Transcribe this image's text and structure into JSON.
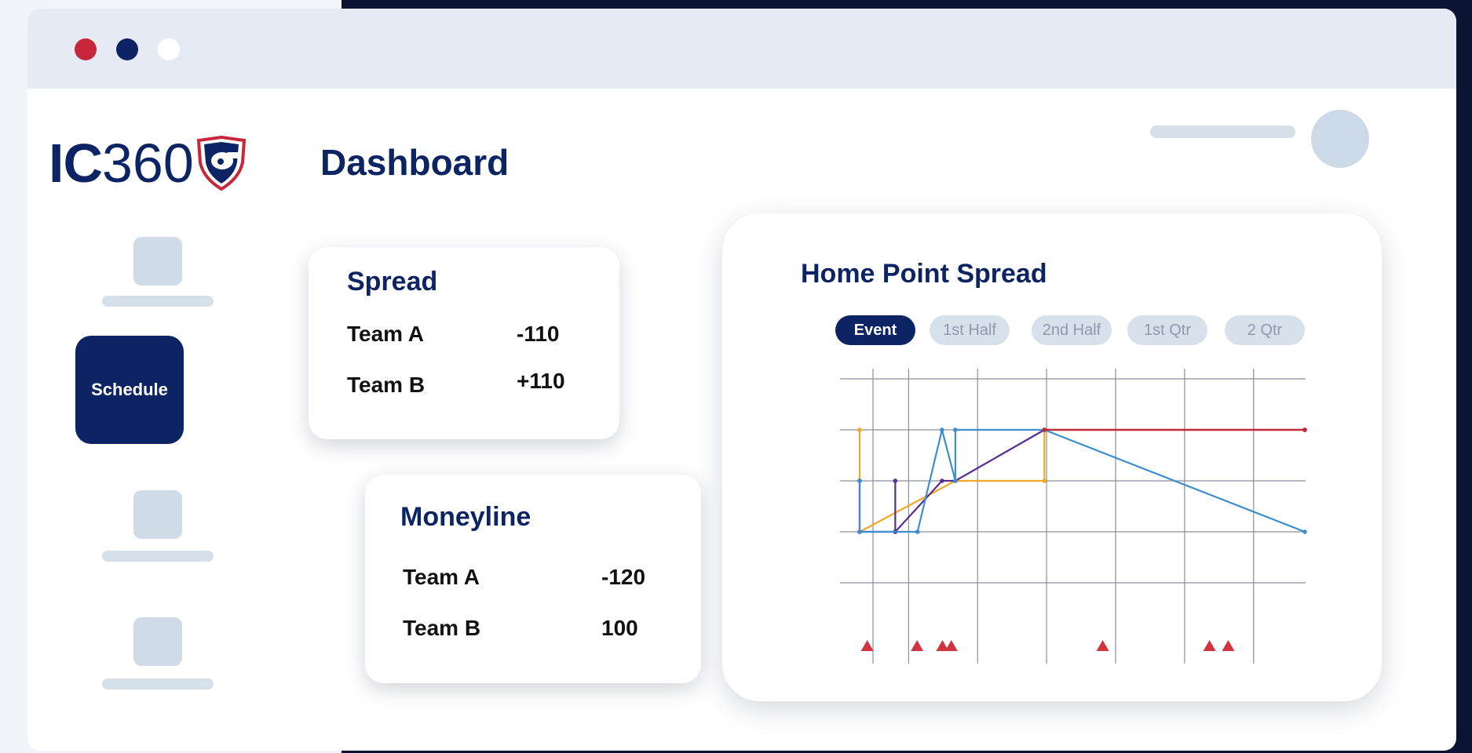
{
  "colors": {
    "navy": "#0c2463",
    "brand_red": "#c8263a",
    "window_bg": "#ffffff",
    "titlebar_bg": "#e6ebf3",
    "placeholder": "#cfdbe7",
    "series_orange": "#f5a623",
    "series_purple": "#5a2d91",
    "series_blue": "#3a8fd0",
    "series_red": "#c8263a",
    "marker_red": "#d0343f"
  },
  "window": {
    "dots": [
      {
        "name": "red-dot",
        "color": "#c8263a"
      },
      {
        "name": "navy-dot",
        "color": "#0c2463"
      },
      {
        "name": "white-dot",
        "color": "#ffffff"
      }
    ]
  },
  "logo": {
    "text_bold": "IC",
    "text_regular": "360",
    "icon": "whistle-shield-icon"
  },
  "header": {
    "title": "Dashboard"
  },
  "sidebar": {
    "items": [
      {
        "label": "",
        "active": false
      },
      {
        "label": "Schedule",
        "active": true
      },
      {
        "label": "",
        "active": false
      },
      {
        "label": "",
        "active": false
      }
    ]
  },
  "spread_card": {
    "title": "Spread",
    "rows": [
      {
        "team": "Team A",
        "value": "-110"
      },
      {
        "team": "Team B",
        "value": "+110"
      }
    ]
  },
  "moneyline_card": {
    "title": "Moneyline",
    "rows": [
      {
        "team": "Team A",
        "value": "-120"
      },
      {
        "team": "Team B",
        "value": "100"
      }
    ]
  },
  "chart_card": {
    "title": "Home Point Spread",
    "tabs": [
      {
        "label": "Event",
        "active": true
      },
      {
        "label": "1st Half",
        "active": false
      },
      {
        "label": "2nd Half",
        "active": false
      },
      {
        "label": "1st Qtr",
        "active": false
      },
      {
        "label": "2 Qtr",
        "active": false
      }
    ]
  },
  "chart_data": {
    "type": "line",
    "title": "Home Point Spread",
    "xlabel": "",
    "ylabel": "",
    "xlim": [
      0,
      100
    ],
    "ylim": [
      0,
      4
    ],
    "grid": true,
    "xgrid": [
      3,
      11,
      26.5,
      42,
      57.5,
      73,
      88.5
    ],
    "ygrid": [
      0,
      1,
      2,
      3,
      4
    ],
    "series": [
      {
        "color": "#f5a623",
        "points": [
          [
            0,
            1
          ],
          [
            0,
            3
          ],
          [
            0,
            1
          ],
          [
            21.5,
            2
          ],
          [
            41.5,
            2
          ],
          [
            41.5,
            3
          ],
          [
            100,
            3
          ]
        ]
      },
      {
        "color": "#5a2d91",
        "points": [
          [
            0,
            2
          ],
          [
            0,
            1
          ],
          [
            8,
            1
          ],
          [
            8,
            2
          ],
          [
            8,
            1
          ],
          [
            18.5,
            2
          ],
          [
            21.5,
            2
          ],
          [
            41.5,
            3
          ],
          [
            100,
            3
          ]
        ]
      },
      {
        "color": "#3a8fd0",
        "points": [
          [
            0,
            2
          ],
          [
            0,
            1
          ],
          [
            13,
            1
          ],
          [
            18.5,
            3
          ],
          [
            21.5,
            2
          ],
          [
            21.5,
            3
          ],
          [
            41.5,
            3
          ],
          [
            100,
            1
          ]
        ]
      },
      {
        "color": "#c8263a",
        "points": [
          [
            41.5,
            3
          ],
          [
            100,
            3
          ]
        ]
      }
    ],
    "markers": {
      "color": "#d0343f",
      "x": [
        1.7,
        12.9,
        18.6,
        20.6,
        54.6,
        78.6,
        82.8
      ]
    }
  }
}
